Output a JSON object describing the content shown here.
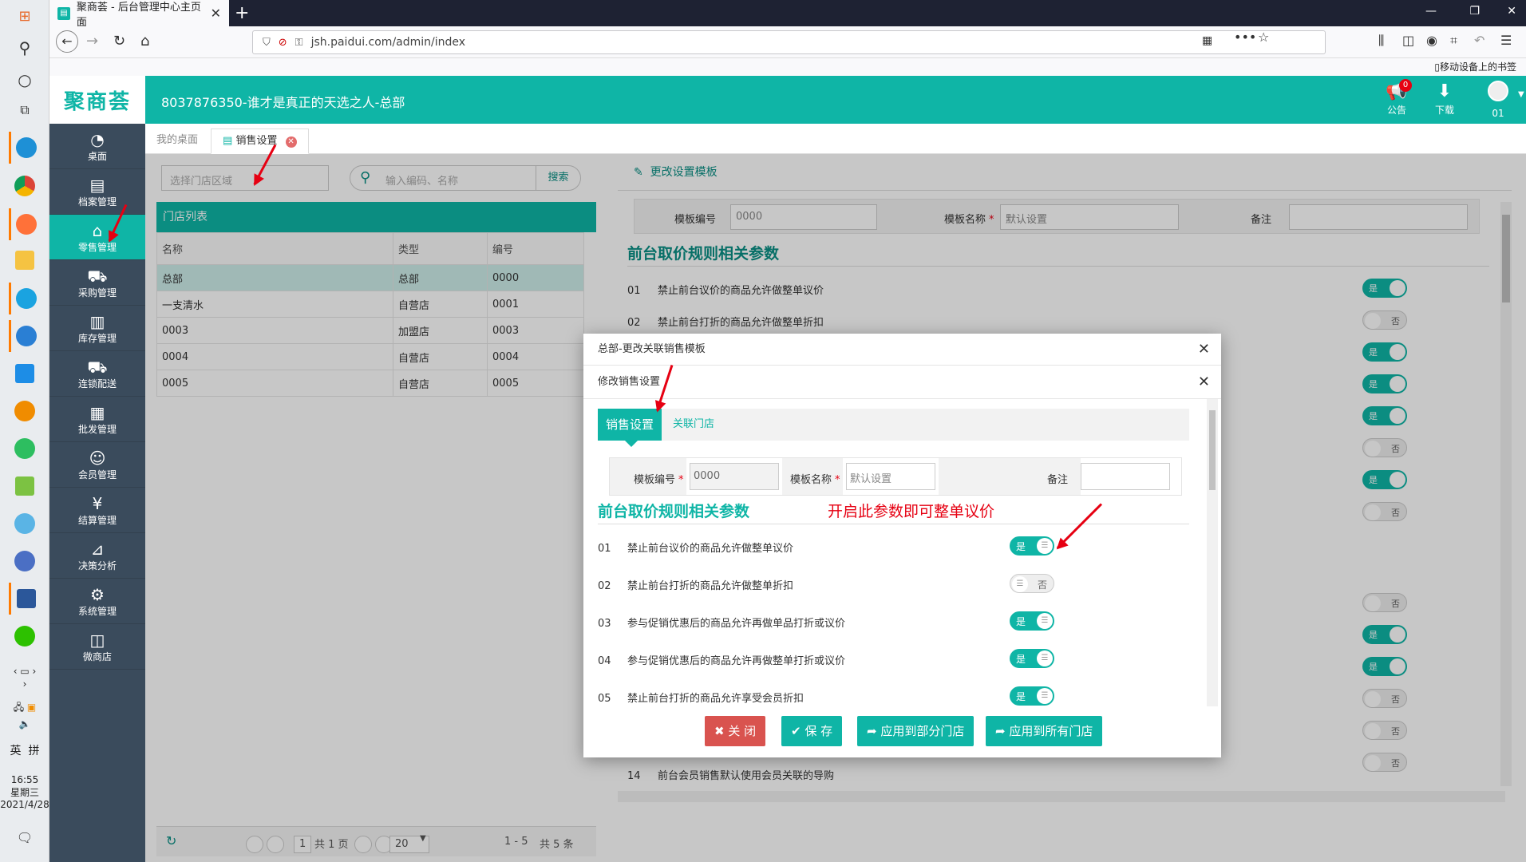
{
  "browser": {
    "tab_title": "聚商荟 - 后台管理中心主页面",
    "tab_close": "✕",
    "new_tab": "+",
    "url": "jsh.paidui.com/admin/index",
    "bookmark_mobile": "移动设备上的书签"
  },
  "taskbar": {
    "time": "16:55",
    "weekday": "星期三",
    "date": "2021/4/28",
    "ime_lang": "英",
    "ime_mode": "拼"
  },
  "header": {
    "logo": "聚商荟",
    "store_title": "8037876350-谁才是真正的天选之人-总部",
    "notice_label": "公告",
    "notice_badge": "0",
    "download_label": "下载",
    "user_label": "01"
  },
  "sidebar": {
    "items": [
      {
        "label": "桌面",
        "icon": "dashboard-icon"
      },
      {
        "label": "档案管理",
        "icon": "archive-icon"
      },
      {
        "label": "零售管理",
        "icon": "store-icon"
      },
      {
        "label": "采购管理",
        "icon": "cart-icon"
      },
      {
        "label": "库存管理",
        "icon": "inventory-icon"
      },
      {
        "label": "连锁配送",
        "icon": "truck-icon"
      },
      {
        "label": "批发管理",
        "icon": "wholesale-icon"
      },
      {
        "label": "会员管理",
        "icon": "member-icon"
      },
      {
        "label": "结算管理",
        "icon": "yen-icon"
      },
      {
        "label": "决策分析",
        "icon": "chart-icon"
      },
      {
        "label": "系统管理",
        "icon": "gear-icon"
      },
      {
        "label": "微商店",
        "icon": "bag-icon"
      }
    ]
  },
  "content_tabs": {
    "desktop": "我的桌面",
    "sales": "销售设置"
  },
  "left": {
    "region_placeholder": "选择门店区域",
    "search_placeholder": "输入编码、名称",
    "search_button": "搜索",
    "list_title": "门店列表",
    "columns": [
      "名称",
      "类型",
      "编号"
    ],
    "rows": [
      [
        "总部",
        "总部",
        "0000"
      ],
      [
        "一支清水",
        "自营店",
        "0001"
      ],
      [
        "0003",
        "加盟店",
        "0003"
      ],
      [
        "0004",
        "自营店",
        "0004"
      ],
      [
        "0005",
        "自营店",
        "0005"
      ]
    ],
    "pager": {
      "page": "1",
      "total_pages": "共 1 页",
      "page_size": "20",
      "range": "1 - 5",
      "total": "共 5 条"
    }
  },
  "right": {
    "tpl_bar": "更改设置模板",
    "code_label": "模板编号",
    "code_value": "0000",
    "name_label": "模板名称",
    "name_value": "默认设置",
    "remark_label": "备注",
    "section_title": "前台取价规则相关参数",
    "rows": [
      {
        "n": "01",
        "text": "禁止前台议价的商品允许做整单议价"
      },
      {
        "n": "02",
        "text": "禁止前台打折的商品允许做整单折扣"
      }
    ],
    "last_row": {
      "n": "14",
      "text": "前台会员销售默认使用会员关联的导购"
    },
    "toggle_yes": "是",
    "toggle_no": "否"
  },
  "modal": {
    "outer_title": "总部-更改关联销售模板",
    "inner_title": "修改销售设置",
    "tab_sales": "销售设置",
    "tab_stores": "关联门店",
    "code_label": "模板编号",
    "code_value": "0000",
    "name_label": "模板名称",
    "name_placeholder": "默认设置",
    "remark_label": "备注",
    "section_title": "前台取价规则相关参数",
    "annotation": "开启此参数即可整单议价",
    "rows": [
      {
        "n": "01",
        "text": "禁止前台议价的商品允许做整单议价",
        "on": true
      },
      {
        "n": "02",
        "text": "禁止前台打折的商品允许做整单折扣",
        "on": false
      },
      {
        "n": "03",
        "text": "参与促销优惠后的商品允许再做单品打折或议价",
        "on": true
      },
      {
        "n": "04",
        "text": "参与促销优惠后的商品允许再做整单打折或议价",
        "on": true
      },
      {
        "n": "05",
        "text": "禁止前台打折的商品允许享受会员折扣",
        "on": true
      }
    ],
    "toggle_yes": "是",
    "toggle_no": "否",
    "btn_close": "✖ 关 闭",
    "btn_save": "✔ 保 存",
    "btn_apply_some": "➦ 应用到部分门店",
    "btn_apply_all": "➦ 应用到所有门店"
  }
}
